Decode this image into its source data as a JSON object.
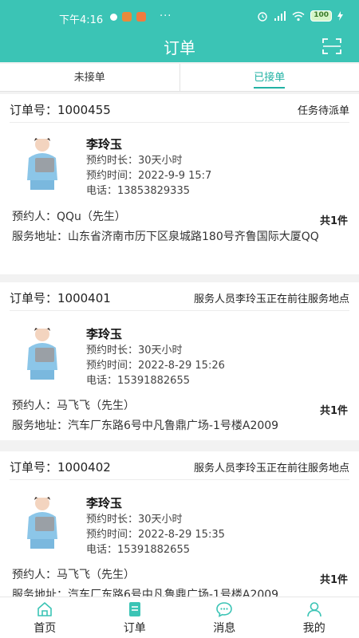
{
  "status_bar": {
    "time": "下午4:16",
    "dots": "···",
    "battery": "100"
  },
  "header": {
    "title": "订单"
  },
  "tabs": [
    {
      "label": "未接单",
      "active": false
    },
    {
      "label": "已接单",
      "active": true
    }
  ],
  "orders": [
    {
      "order_no": "订单号：1000455",
      "status": "任务待派单",
      "worker_name": "李玲玉",
      "duration": "预约时长：30天小时",
      "time": "预约时间：2022-9-9 15:7",
      "phone": "电话：13853829335",
      "booker": "预约人：QQu（先生）",
      "count": "共1件",
      "address": "服务地址：山东省济南市历下区泉城路180号齐鲁国际大厦QQ"
    },
    {
      "order_no": "订单号：1000401",
      "status": "服务人员李玲玉正在前往服务地点",
      "worker_name": "李玲玉",
      "duration": "预约时长：30天小时",
      "time": "预约时间：2022-8-29 15:26",
      "phone": "电话：15391882655",
      "booker": "预约人：马飞飞（先生）",
      "count": "共1件",
      "address": "服务地址：汽车厂东路6号中凡鲁鼎广场-1号楼A2009"
    },
    {
      "order_no": "订单号：1000402",
      "status": "服务人员李玲玉正在前往服务地点",
      "worker_name": "李玲玉",
      "duration": "预约时长：30天小时",
      "time": "预约时间：2022-8-29 15:35",
      "phone": "电话：15391882655",
      "booker": "预约人：马飞飞（先生）",
      "count": "共1件",
      "address": "服务地址：汽车厂东路6号中凡鲁鼎广场-1号楼A2009"
    }
  ],
  "bottom_nav": [
    {
      "label": "首页",
      "icon": "home-icon",
      "active": false
    },
    {
      "label": "订单",
      "icon": "order-icon",
      "active": true
    },
    {
      "label": "消息",
      "icon": "message-icon",
      "active": false
    },
    {
      "label": "我的",
      "icon": "user-icon",
      "active": false
    }
  ],
  "colors": {
    "brand": "#3bc4b5",
    "active_tab": "#22b2a4",
    "background": "#f2f2f2"
  }
}
